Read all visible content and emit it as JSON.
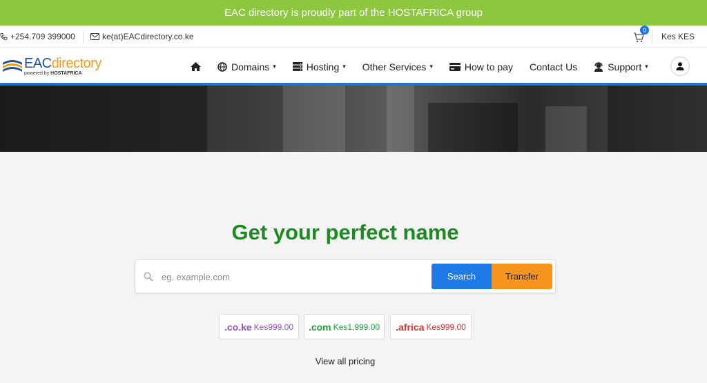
{
  "banner": {
    "text": "EAC directory is proudly part of the HOSTAFRICA group"
  },
  "topbar": {
    "phone": "+254.709 399000",
    "email": "ke(at)EACdirectory.co.ke",
    "cart_count": "0",
    "currency": "Kes KES"
  },
  "logo": {
    "brand_a": "EAC",
    "brand_b": "directory",
    "tagline_a": "powered by ",
    "tagline_b": "HOSTAFRICA"
  },
  "nav": {
    "items": [
      {
        "label": "",
        "icon": "home-icon"
      },
      {
        "label": "Domains",
        "icon": "globe-icon",
        "dropdown": true
      },
      {
        "label": "Hosting",
        "icon": "server-icon",
        "dropdown": true
      },
      {
        "label": "Other Services",
        "dropdown": true
      },
      {
        "label": "How to pay",
        "icon": "credit-card-icon"
      },
      {
        "label": "Contact Us"
      },
      {
        "label": "Support",
        "icon": "headset-icon",
        "dropdown": true
      }
    ],
    "caret": "▾"
  },
  "hero": {
    "headline": "Get your perfect name",
    "search_placeholder": "eg. example.com",
    "search_label": "Search",
    "transfer_label": "Transfer"
  },
  "tlds": [
    {
      "name": ".co.ke",
      "price": "Kes999.00",
      "color": "#9b4fc1"
    },
    {
      "name": ".com",
      "price": "Kes1,999.00",
      "color": "#1e9d3e"
    },
    {
      "name": ".africa",
      "price": "Kes999.00",
      "color": "#d62f2f"
    }
  ],
  "view_all": "View all pricing",
  "colors": {
    "banner": "#8dc63f",
    "accent": "#1e73d8",
    "headline": "#1d8a21",
    "transfer": "#f7941d"
  }
}
